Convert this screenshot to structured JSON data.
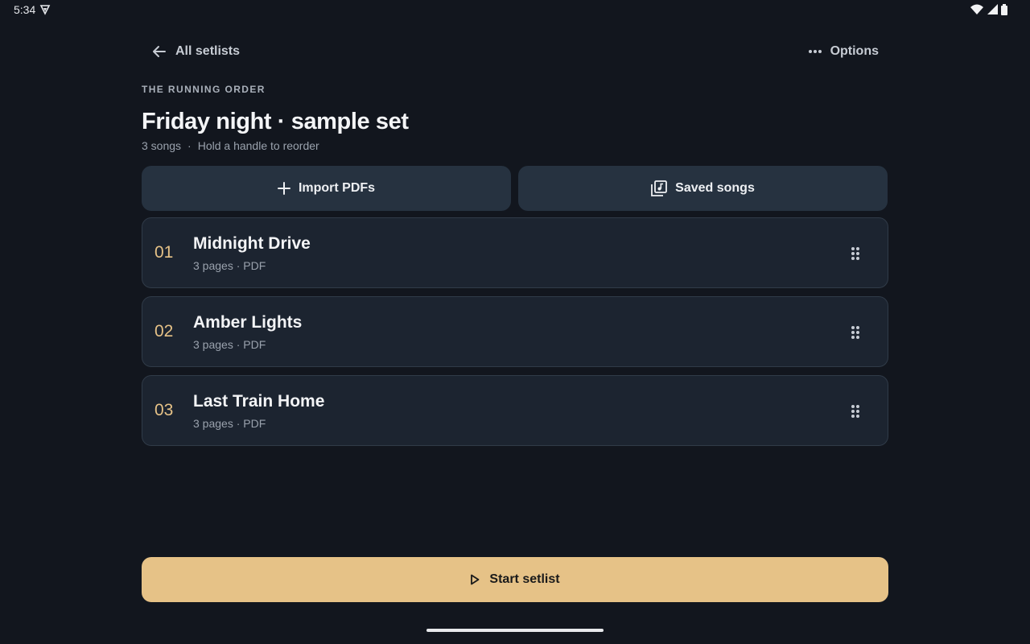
{
  "status_bar": {
    "time": "5:34",
    "vpn_icon": "vpn-shield-icon",
    "wifi_icon": "wifi-icon",
    "signal_icon": "cell-signal-icon",
    "battery_icon": "battery-icon"
  },
  "nav": {
    "back_label": "All setlists",
    "back_icon": "arrow-left-icon",
    "options_label": "Options",
    "options_icon": "more-horizontal-icon"
  },
  "header": {
    "eyebrow": "THE RUNNING ORDER",
    "title": "Friday night · sample set",
    "song_count": "3 songs",
    "separator": "·",
    "hint": "Hold a handle to reorder"
  },
  "actions": {
    "import_label": "Import PDFs",
    "import_icon": "plus-icon",
    "saved_label": "Saved songs",
    "saved_icon": "music-library-icon"
  },
  "songs": [
    {
      "number": "01",
      "title": "Midnight Drive",
      "meta": "3 pages · PDF"
    },
    {
      "number": "02",
      "title": "Amber Lights",
      "meta": "3 pages · PDF"
    },
    {
      "number": "03",
      "title": "Last Train Home",
      "meta": "3 pages · PDF"
    }
  ],
  "start": {
    "label": "Start setlist",
    "icon": "play-icon"
  },
  "colors": {
    "background": "#12161e",
    "card": "#1c2430",
    "button": "#263240",
    "accent": "#e6c287"
  }
}
